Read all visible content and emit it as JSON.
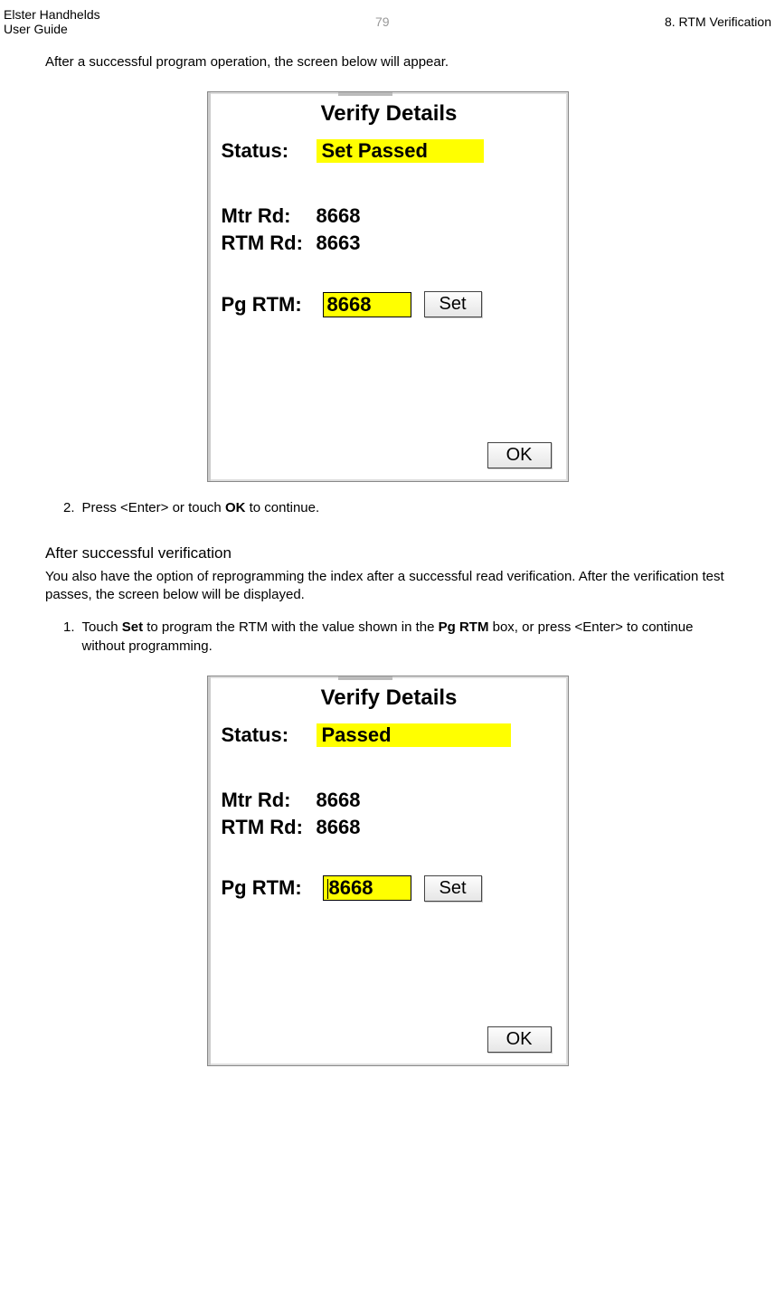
{
  "header": {
    "doc_title_line1": "Elster Handhelds",
    "doc_title_line2": "User Guide",
    "page_number": "79",
    "section": "8. RTM Verification"
  },
  "intro_text": "After a successful program operation, the screen below will appear.",
  "screen1": {
    "title": "Verify Details",
    "status_label": "Status:",
    "status_value": "Set Passed",
    "mtr_label": "Mtr Rd:",
    "mtr_value": "8668",
    "rtm_label": "RTM Rd:",
    "rtm_value": "8663",
    "pg_label": "Pg RTM:",
    "pg_value": "8668",
    "set_label": "Set",
    "ok_label": "OK"
  },
  "step2": {
    "num": "2.",
    "text_prefix": "Press <Enter> or touch ",
    "bold1": "OK",
    "text_suffix": " to continue."
  },
  "after_section": {
    "heading": "After successful verification",
    "para": "You also have the option of reprogramming the index after a successful read verification. After the verification test passes, the screen below will be displayed."
  },
  "step1b": {
    "num": "1.",
    "t1": "Touch ",
    "b1": "Set",
    "t2": " to program the RTM with the value shown in the ",
    "b2": "Pg RTM",
    "t3": " box, or press <Enter> to continue without programming."
  },
  "screen2": {
    "title": "Verify Details",
    "status_label": "Status:",
    "status_value": "Passed",
    "mtr_label": "Mtr Rd:",
    "mtr_value": "8668",
    "rtm_label": "RTM Rd:",
    "rtm_value": "8668",
    "pg_label": "Pg RTM:",
    "pg_value": "8668",
    "set_label": "Set",
    "ok_label": "OK"
  }
}
